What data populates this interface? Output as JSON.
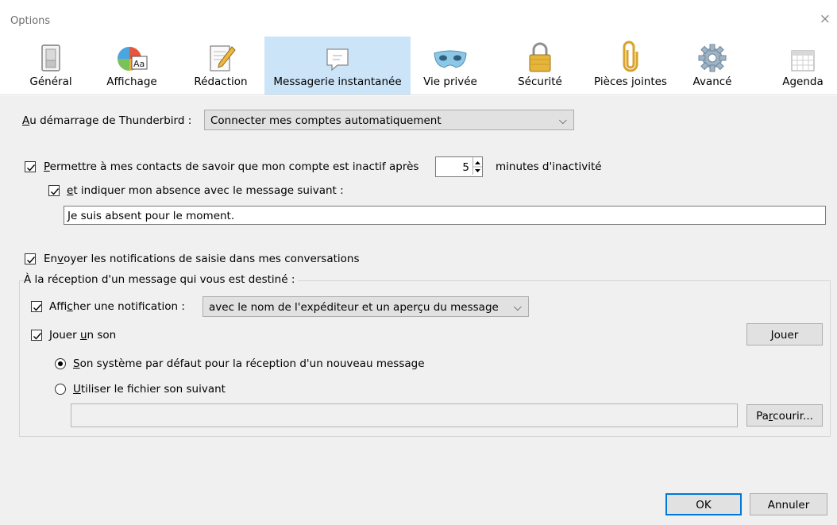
{
  "window": {
    "title": "Options",
    "close_glyph": "×"
  },
  "toolbar": {
    "panes": [
      {
        "label": "Général",
        "icon": "general-icon"
      },
      {
        "label": "Affichage",
        "icon": "display-icon"
      },
      {
        "label": "Rédaction",
        "icon": "compose-icon"
      },
      {
        "label": "Messagerie instantanée",
        "icon": "chat-icon",
        "selected": true
      },
      {
        "label": "Vie privée",
        "icon": "privacy-mask-icon"
      },
      {
        "label": "Sécurité",
        "icon": "padlock-icon"
      },
      {
        "label": "Pièces jointes",
        "icon": "paperclip-icon"
      },
      {
        "label": "Avancé",
        "icon": "gear-icon"
      },
      {
        "label": "Agenda",
        "icon": "calendar-icon"
      }
    ]
  },
  "startup": {
    "label_pre": "A",
    "label_rest": "u démarrage de Thunderbird :",
    "value": "Connecter mes comptes automatiquement"
  },
  "idle": {
    "checked": true,
    "label_pre": "",
    "label_u": "P",
    "label_rest": "ermettre à mes contacts de savoir que mon compte est inactif après",
    "minutes": "5",
    "suffix": "minutes d'inactivité",
    "away_checked": true,
    "away_label_u": "e",
    "away_label_rest": "t indiquer mon absence avec le message suivant :",
    "away_message": "Je suis absent pour le moment."
  },
  "typing": {
    "checked": true,
    "label_pre": "En",
    "label_u": "v",
    "label_rest": "oyer les notifications de saisie dans mes conversations"
  },
  "incoming": {
    "group_label": "À la réception d'un message qui vous est destiné :",
    "notify_checked": true,
    "notify_pre": "Affi",
    "notify_u": "c",
    "notify_rest": "her une notification :",
    "notify_value": "avec le nom de l'expéditeur et un aperçu du message",
    "sound_checked": true,
    "sound_pre": "Jouer ",
    "sound_u": "u",
    "sound_rest": "n son",
    "play_u": "J",
    "play_rest": "ouer",
    "default_sound_selected": true,
    "default_sound_u": "S",
    "default_sound_rest": "on système par défaut pour la réception d'un nouveau message",
    "custom_sound_u": "U",
    "custom_sound_rest": "tiliser le fichier son suivant",
    "file_path": "",
    "browse_pre": "Pa",
    "browse_u": "r",
    "browse_rest": "courir..."
  },
  "footer": {
    "ok": "OK",
    "cancel": "Annuler"
  }
}
